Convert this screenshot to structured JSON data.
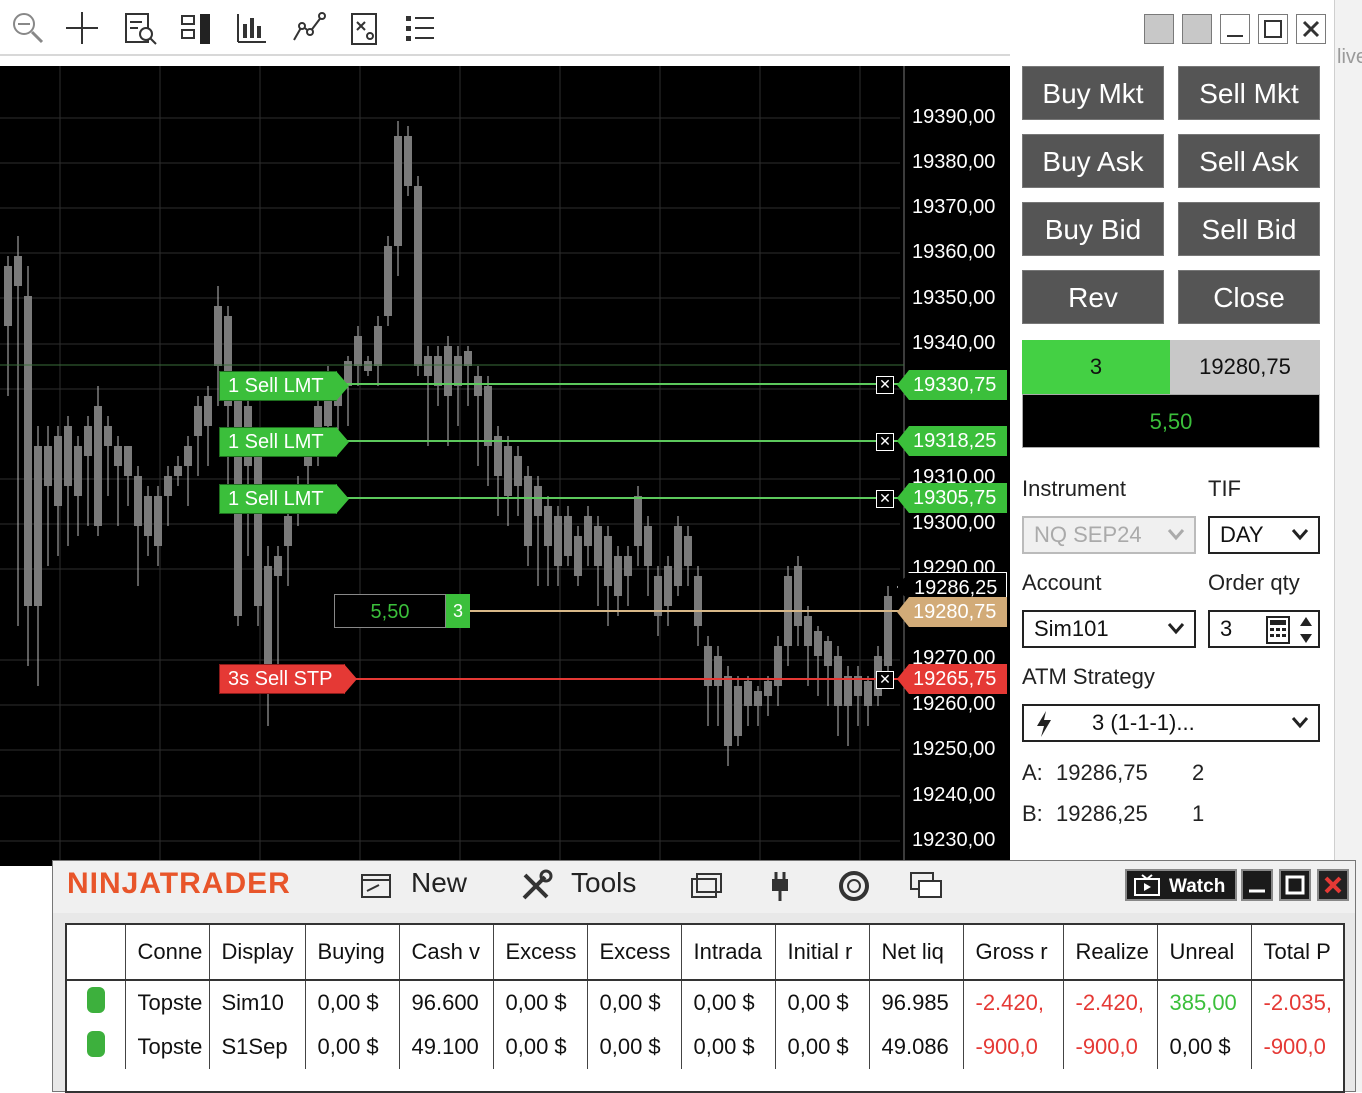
{
  "toolbar": {
    "icons": [
      "zoom-out-icon",
      "crosshair-icon",
      "data-box-icon",
      "bar-type-icon",
      "indicators-icon",
      "drawing-tools-icon",
      "strategies-icon",
      "properties-list-icon"
    ]
  },
  "right_strip_text": "live",
  "chart": {
    "price_axis": [
      "19390,00",
      "19380,00",
      "19370,00",
      "19360,00",
      "19350,00",
      "19340,00",
      "19310,00",
      "19300,00",
      "19290,00",
      "19270,00",
      "19260,00",
      "19250,00",
      "19240,00",
      "19230,00"
    ],
    "orders": [
      {
        "label": "1 Sell LMT",
        "price": "19330,75",
        "type": "limit"
      },
      {
        "label": "1 Sell LMT",
        "price": "19318,25",
        "type": "limit"
      },
      {
        "label": "1 Sell LMT",
        "price": "19305,75",
        "type": "limit"
      },
      {
        "label": "3s Sell STP",
        "price": "19265,75",
        "type": "stop"
      }
    ],
    "position": {
      "pnl": "5,50",
      "qty": "3",
      "price": "19280,75"
    },
    "last_price": "19286,25",
    "cancel_glyph": "✕"
  },
  "trader": {
    "buttons": [
      "Buy Mkt",
      "Sell Mkt",
      "Buy Ask",
      "Sell Ask",
      "Buy Bid",
      "Sell Bid",
      "Rev",
      "Close"
    ],
    "position_qty": "3",
    "position_price": "19280,75",
    "position_pnl": "5,50",
    "instrument_label": "Instrument",
    "tif_label": "TIF",
    "instrument_value": "NQ SEP24",
    "tif_value": "DAY",
    "account_label": "Account",
    "order_qty_label": "Order qty",
    "account_value": "Sim101",
    "order_qty_value": "3",
    "atm_label": "ATM Strategy",
    "atm_value": "3 (1-1-1)...",
    "ask_label": "A:",
    "ask_price": "19286,75",
    "ask_size": "2",
    "bid_label": "B:",
    "bid_price": "19286,25",
    "bid_size": "1",
    "colors": {
      "button": "#555555",
      "long": "#44d044",
      "loss": "#e53935"
    }
  },
  "control_center": {
    "logo": "NINJATRADER",
    "menu": {
      "new": "New",
      "tools": "Tools"
    },
    "watch": "Watch",
    "columns": [
      "",
      "Conne",
      "Display",
      "Buying",
      "Cash v",
      "Excess",
      "Excess",
      "Intrada",
      "Initial r",
      "Net liq",
      "Gross r",
      "Realize",
      "Unreal",
      "Total P"
    ],
    "rows": [
      [
        "",
        "Topste",
        "Sim10",
        "0,00 $",
        "96.600",
        "0,00 $",
        "0,00 $",
        "0,00 $",
        "0,00 $",
        "96.985",
        "-2.420,",
        "-2.420,",
        "385,00",
        "-2.035,"
      ],
      [
        "",
        "Topste",
        "S1Sep",
        "0,00 $",
        "49.100",
        "0,00 $",
        "0,00 $",
        "0,00 $",
        "0,00 $",
        "49.086",
        "-900,0",
        "-900,0",
        "0,00 $",
        "-900,0"
      ]
    ]
  }
}
